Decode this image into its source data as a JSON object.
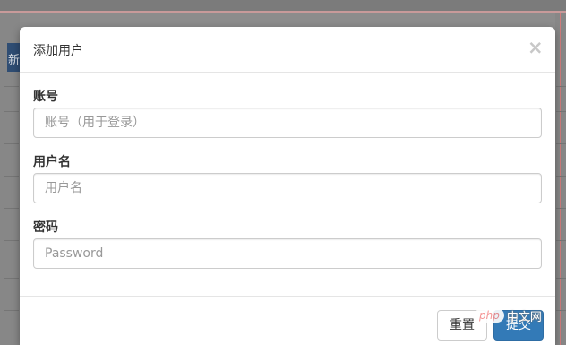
{
  "dialog": {
    "title": "添加用户",
    "close_symbol": "×"
  },
  "form": {
    "account": {
      "label": "账号",
      "placeholder": "账号（用于登录）",
      "value": ""
    },
    "username": {
      "label": "用户名",
      "placeholder": "用户名",
      "value": ""
    },
    "password": {
      "label": "密码",
      "placeholder": "Password",
      "value": ""
    }
  },
  "footer": {
    "reset_label": "重置",
    "submit_label": "提交"
  },
  "watermark": {
    "badge": "php",
    "text": "中文网"
  },
  "background": {
    "chip_text": "新增"
  },
  "colors": {
    "primary": "#337ab7",
    "overlay": "#8c8c8c",
    "border": "#cccccc"
  }
}
